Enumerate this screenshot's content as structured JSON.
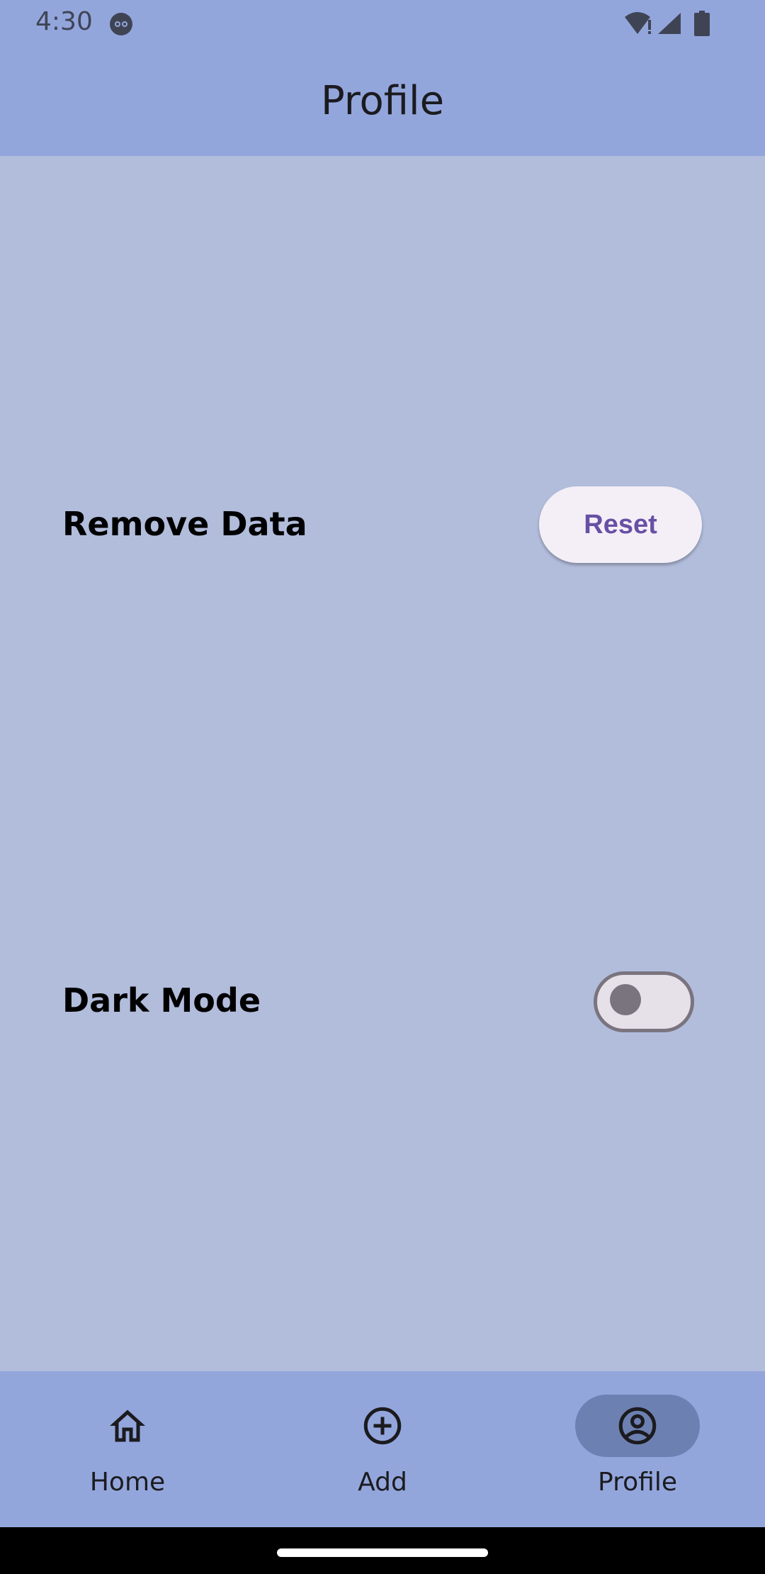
{
  "status_bar": {
    "time": "4:30",
    "icons": [
      "app-notification-icon",
      "wifi-alert-icon",
      "signal-icon",
      "battery-icon"
    ]
  },
  "app_bar": {
    "title": "Profile"
  },
  "settings": {
    "remove_data": {
      "label": "Remove Data",
      "button_label": "Reset"
    },
    "dark_mode": {
      "label": "Dark Mode",
      "enabled": false
    }
  },
  "bottom_nav": {
    "items": [
      {
        "label": "Home",
        "icon": "home-icon",
        "selected": false
      },
      {
        "label": "Add",
        "icon": "add-circle-icon",
        "selected": false
      },
      {
        "label": "Profile",
        "icon": "account-circle-icon",
        "selected": true
      }
    ]
  },
  "colors": {
    "background": "#b2bddc",
    "bars": "#93a6dc",
    "accent": "#6750a4",
    "nav_indicator": "#6d80b2"
  }
}
